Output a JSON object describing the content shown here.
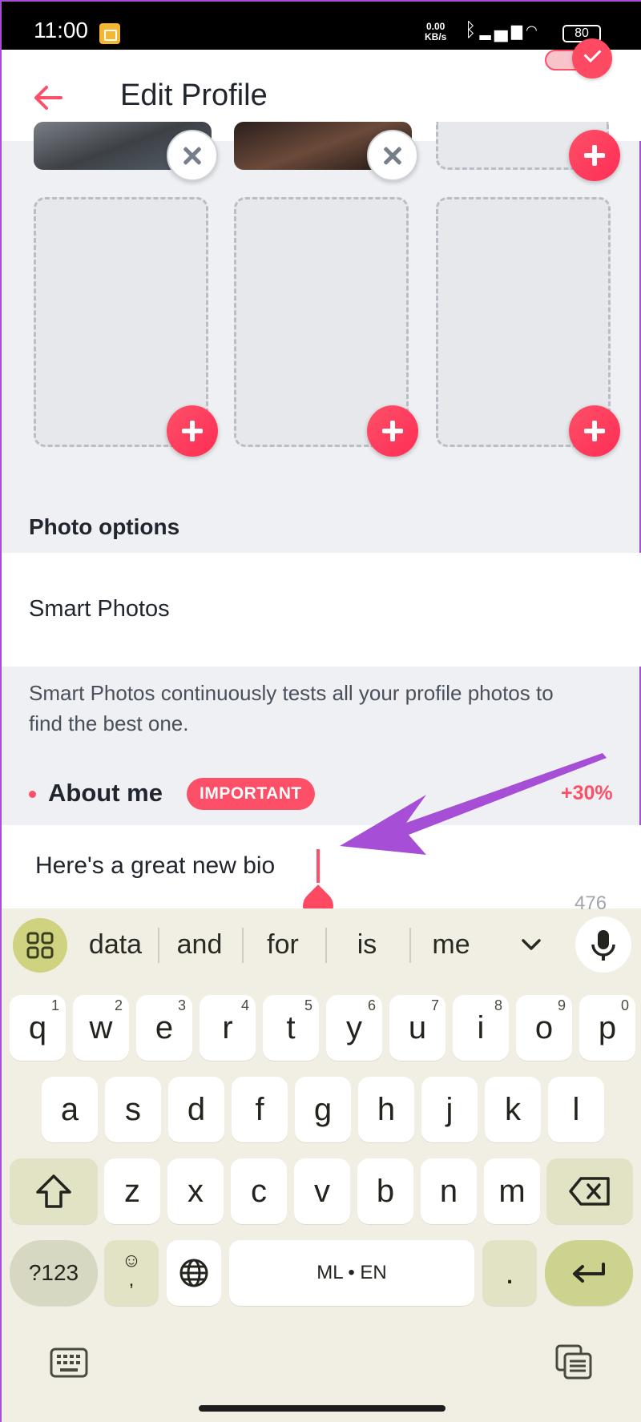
{
  "status_bar": {
    "time": "11:00",
    "net_speed_value": "0.00",
    "net_speed_unit": "KB/s",
    "battery": "80"
  },
  "header": {
    "title": "Edit Profile"
  },
  "photo_options": {
    "heading": "Photo options",
    "smart_photos_label": "Smart Photos",
    "smart_photos_enabled": true,
    "smart_photos_description": "Smart Photos continuously tests all your profile photos to find the best one."
  },
  "about_me": {
    "heading": "About me",
    "badge": "IMPORTANT",
    "boost": "+30%",
    "bio_value": "Here's a great new bio",
    "char_count": "476"
  },
  "keyboard": {
    "suggestions": [
      "data",
      "and",
      "for",
      "is",
      "me"
    ],
    "row1": [
      {
        "k": "q",
        "n": "1"
      },
      {
        "k": "w",
        "n": "2"
      },
      {
        "k": "e",
        "n": "3"
      },
      {
        "k": "r",
        "n": "4"
      },
      {
        "k": "t",
        "n": "5"
      },
      {
        "k": "y",
        "n": "6"
      },
      {
        "k": "u",
        "n": "7"
      },
      {
        "k": "i",
        "n": "8"
      },
      {
        "k": "o",
        "n": "9"
      },
      {
        "k": "p",
        "n": "0"
      }
    ],
    "row2": [
      "a",
      "s",
      "d",
      "f",
      "g",
      "h",
      "j",
      "k",
      "l"
    ],
    "row3": [
      "z",
      "x",
      "c",
      "v",
      "b",
      "n",
      "m"
    ],
    "symbols_key": "?123",
    "emoji_key": "☺\n,",
    "space_label": "ML • EN",
    "period_key": "."
  },
  "colors": {
    "accent": "#fd5068",
    "annotation_arrow": "#a64fd6",
    "keyboard_bg": "#f1efe3"
  }
}
